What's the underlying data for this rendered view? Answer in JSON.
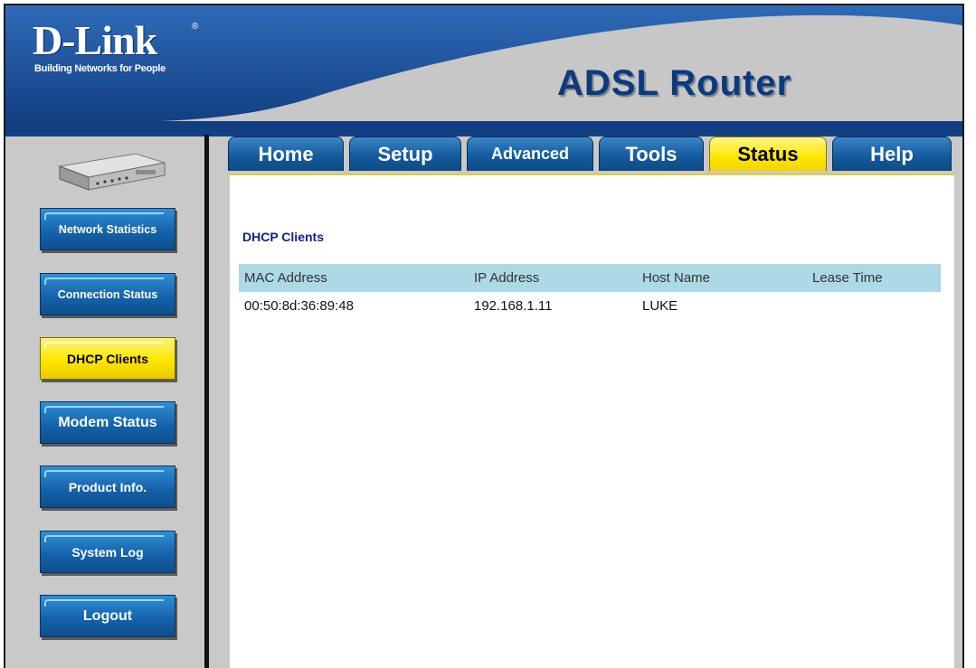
{
  "brand": {
    "logo": "D-Link",
    "registered": "®",
    "tagline": "Building Networks for People",
    "product": "ADSL Router"
  },
  "tabs": [
    {
      "label": "Home",
      "active": false
    },
    {
      "label": "Setup",
      "active": false
    },
    {
      "label": "Advanced",
      "active": false
    },
    {
      "label": "Tools",
      "active": false
    },
    {
      "label": "Status",
      "active": true
    },
    {
      "label": "Help",
      "active": false
    }
  ],
  "sidebar": {
    "items": [
      {
        "label": "Network Statistics",
        "active": false
      },
      {
        "label": "Connection Status",
        "active": false
      },
      {
        "label": "DHCP Clients",
        "active": true
      },
      {
        "label": "Modem Status",
        "active": false
      },
      {
        "label": "Product Info.",
        "active": false
      },
      {
        "label": "System Log",
        "active": false
      },
      {
        "label": "Logout",
        "active": false
      }
    ]
  },
  "main": {
    "title": "DHCP Clients",
    "table": {
      "headers": [
        "MAC Address",
        "IP Address",
        "Host Name",
        "Lease Time"
      ],
      "rows": [
        [
          "00:50:8d:36:89:48",
          "192.168.1.11",
          "LUKE",
          ""
        ]
      ]
    }
  },
  "colors": {
    "header_blue": "#1c5aa8",
    "tab_blue": "#145b9e",
    "active_yellow": "#ffe600",
    "table_header": "#add8e6",
    "title_text": "#0f1f8f"
  }
}
